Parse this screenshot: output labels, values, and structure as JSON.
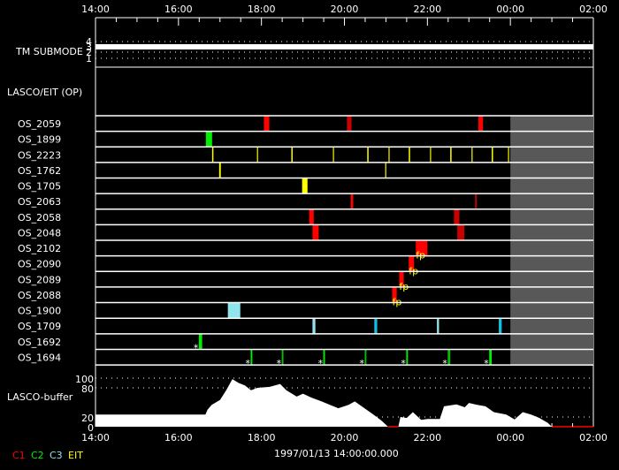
{
  "chart_data": {
    "type": "timeline",
    "time_range_hours": [
      14,
      26
    ],
    "x_tick_labels": [
      "14:00",
      "16:00",
      "18:00",
      "20:00",
      "22:00",
      "00:00",
      "02:00"
    ],
    "tm_submode": {
      "label": "TM SUBMODE",
      "levels": [
        "4",
        "3",
        "2",
        "1"
      ],
      "value": 3
    },
    "section_label": "LASCO/EIT (OP)",
    "unavailable_from_hour": 24.0,
    "rows": [
      {
        "name": "OS_2059",
        "events": [
          {
            "s": 18.06,
            "e": 18.19,
            "c": "#ff0000"
          },
          {
            "s": 20.06,
            "e": 20.17,
            "c": "#c80000"
          },
          {
            "s": 23.23,
            "e": 23.34,
            "c": "#ff0000"
          }
        ]
      },
      {
        "name": "OS_1899",
        "events": [
          {
            "s": 16.66,
            "e": 16.81,
            "c": "#00ee00"
          }
        ]
      },
      {
        "name": "OS_2223",
        "events": [
          {
            "s": 16.81,
            "e": 16.83,
            "c": "#ffff00"
          },
          {
            "s": 17.89,
            "e": 17.91,
            "c": "#c8c800"
          },
          {
            "s": 18.72,
            "e": 18.74,
            "c": "#ffff00"
          },
          {
            "s": 19.72,
            "e": 19.74,
            "c": "#c8c800"
          },
          {
            "s": 20.55,
            "e": 20.57,
            "c": "#ffff00"
          },
          {
            "s": 21.06,
            "e": 21.08,
            "c": "#c8c800"
          },
          {
            "s": 21.55,
            "e": 21.57,
            "c": "#ffff00"
          },
          {
            "s": 22.06,
            "e": 22.08,
            "c": "#c8c800"
          },
          {
            "s": 22.55,
            "e": 22.57,
            "c": "#ffff00"
          },
          {
            "s": 23.06,
            "e": 23.08,
            "c": "#c8c800"
          },
          {
            "s": 23.55,
            "e": 23.57,
            "c": "#ffff00"
          },
          {
            "s": 23.94,
            "e": 23.96,
            "c": "#c8c800"
          }
        ]
      },
      {
        "name": "OS_1762",
        "events": [
          {
            "s": 16.98,
            "e": 17.02,
            "c": "#ffff00"
          },
          {
            "s": 20.98,
            "e": 21.0,
            "c": "#c8c800"
          }
        ]
      },
      {
        "name": "OS_1705",
        "events": [
          {
            "s": 18.98,
            "e": 19.11,
            "c": "#ffff00"
          }
        ]
      },
      {
        "name": "OS_2063",
        "events": [
          {
            "s": 20.15,
            "e": 20.21,
            "c": "#ff0000"
          },
          {
            "s": 23.15,
            "e": 23.19,
            "c": "#c80000"
          }
        ]
      },
      {
        "name": "OS_2058",
        "events": [
          {
            "s": 19.15,
            "e": 19.26,
            "c": "#ff0000"
          },
          {
            "s": 22.64,
            "e": 22.77,
            "c": "#c80000"
          }
        ]
      },
      {
        "name": "OS_2048",
        "events": [
          {
            "s": 19.23,
            "e": 19.38,
            "c": "#ff0000"
          },
          {
            "s": 22.72,
            "e": 22.89,
            "c": "#c80000"
          }
        ]
      },
      {
        "name": "OS_2102",
        "events": [
          {
            "s": 21.72,
            "e": 22.0,
            "c": "#ff0000",
            "note": "fp"
          }
        ]
      },
      {
        "name": "OS_2090",
        "events": [
          {
            "s": 21.55,
            "e": 21.68,
            "c": "#ff0000",
            "note": "fp"
          }
        ]
      },
      {
        "name": "OS_2089",
        "events": [
          {
            "s": 21.32,
            "e": 21.43,
            "c": "#ff0000",
            "note": "fp"
          }
        ]
      },
      {
        "name": "OS_2088",
        "events": [
          {
            "s": 21.15,
            "e": 21.26,
            "c": "#ff0000",
            "note": "fp"
          }
        ]
      },
      {
        "name": "OS_1900",
        "events": [
          {
            "s": 17.19,
            "e": 17.49,
            "c": "#90e4ee"
          }
        ]
      },
      {
        "name": "OS_1709",
        "events": [
          {
            "s": 19.23,
            "e": 19.3,
            "c": "#90e4ee"
          },
          {
            "s": 20.72,
            "e": 20.79,
            "c": "#10c0e0"
          },
          {
            "s": 22.23,
            "e": 22.28,
            "c": "#90e4ee"
          },
          {
            "s": 23.72,
            "e": 23.79,
            "c": "#10c0e0"
          }
        ]
      },
      {
        "name": "OS_1692",
        "events": [
          {
            "s": 16.49,
            "e": 16.57,
            "c": "#00ee00",
            "note": "*"
          }
        ]
      },
      {
        "name": "OS_1694",
        "events": [
          {
            "s": 17.74,
            "e": 17.78,
            "c": "#00ee00",
            "note": "*"
          },
          {
            "s": 18.49,
            "e": 18.53,
            "c": "#00c000",
            "note": "*"
          },
          {
            "s": 19.49,
            "e": 19.53,
            "c": "#00ee00",
            "note": "*"
          },
          {
            "s": 20.49,
            "e": 20.53,
            "c": "#00c000",
            "note": "*"
          },
          {
            "s": 21.49,
            "e": 21.53,
            "c": "#00ee00",
            "note": "*"
          },
          {
            "s": 22.49,
            "e": 22.55,
            "c": "#00c000",
            "note": "*"
          },
          {
            "s": 23.49,
            "e": 23.55,
            "c": "#00ee00",
            "note": "*"
          }
        ]
      }
    ],
    "buffer": {
      "label": "LASCO-buffer",
      "y_ticks": [
        "100",
        "80",
        "20",
        "0"
      ],
      "ylim": [
        0,
        100
      ],
      "points": [
        [
          14,
          25
        ],
        [
          16.65,
          25
        ],
        [
          16.7,
          35
        ],
        [
          16.8,
          45
        ],
        [
          17.0,
          55
        ],
        [
          17.15,
          75
        ],
        [
          17.3,
          98
        ],
        [
          17.45,
          90
        ],
        [
          17.6,
          85
        ],
        [
          17.75,
          75
        ],
        [
          17.9,
          80
        ],
        [
          18.2,
          82
        ],
        [
          18.45,
          88
        ],
        [
          18.6,
          75
        ],
        [
          18.85,
          62
        ],
        [
          19.0,
          68
        ],
        [
          19.2,
          60
        ],
        [
          19.45,
          52
        ],
        [
          19.65,
          45
        ],
        [
          19.85,
          38
        ],
        [
          20.1,
          45
        ],
        [
          20.25,
          52
        ],
        [
          20.45,
          40
        ],
        [
          20.7,
          25
        ],
        [
          20.9,
          12
        ],
        [
          21.05,
          0
        ],
        [
          21.3,
          0
        ],
        [
          21.35,
          20
        ],
        [
          21.5,
          18
        ],
        [
          21.65,
          30
        ],
        [
          21.85,
          14
        ],
        [
          22.0,
          16
        ],
        [
          22.3,
          16
        ],
        [
          22.4,
          42
        ],
        [
          22.7,
          46
        ],
        [
          22.9,
          40
        ],
        [
          23.0,
          49
        ],
        [
          23.2,
          45
        ],
        [
          23.4,
          42
        ],
        [
          23.6,
          30
        ],
        [
          23.9,
          25
        ],
        [
          24.1,
          15
        ],
        [
          24.3,
          30
        ],
        [
          24.5,
          25
        ],
        [
          24.7,
          18
        ],
        [
          24.9,
          8
        ],
        [
          25.0,
          0
        ],
        [
          26,
          0
        ]
      ],
      "zero_segments": [
        [
          21.05,
          21.3
        ],
        [
          25.0,
          26.0
        ]
      ]
    },
    "legend": [
      {
        "label": "C1",
        "color": "#ff0000"
      },
      {
        "label": "C2",
        "color": "#00ee00"
      },
      {
        "label": "C3",
        "color": "#90e4ee"
      },
      {
        "label": "EIT",
        "color": "#ffff00"
      }
    ],
    "start_time": "1997/01/13 14:00:00.000"
  }
}
